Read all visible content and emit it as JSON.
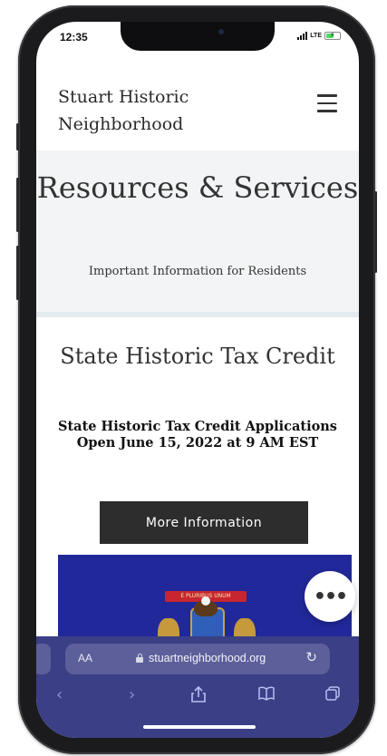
{
  "status_bar": {
    "time": "12:35",
    "network": "LTE",
    "battery_level": 0.6
  },
  "site": {
    "title": "Stuart Historic Neighborhood",
    "menu_icon": "hamburger-menu-icon"
  },
  "hero": {
    "title": "Resources & Services",
    "subtitle": "Important Information for Residents"
  },
  "article": {
    "title": "State Historic Tax Credit",
    "announcement": "State Historic Tax Credit Applications Open June 15, 2022 at 9 AM EST",
    "button_label": "More Information"
  },
  "flag_image": {
    "ribbon_text": "E PLURIBUS UNUM",
    "background_color": "#21289a"
  },
  "fab": {
    "label": "•••"
  },
  "browser": {
    "reader_label": "AA",
    "url": "stuartneighborhood.org",
    "toolbar_color": "#3b3f86",
    "icons": [
      "back-icon",
      "forward-icon",
      "share-icon",
      "bookmarks-icon",
      "tabs-icon",
      "reload-icon",
      "lock-icon"
    ]
  }
}
